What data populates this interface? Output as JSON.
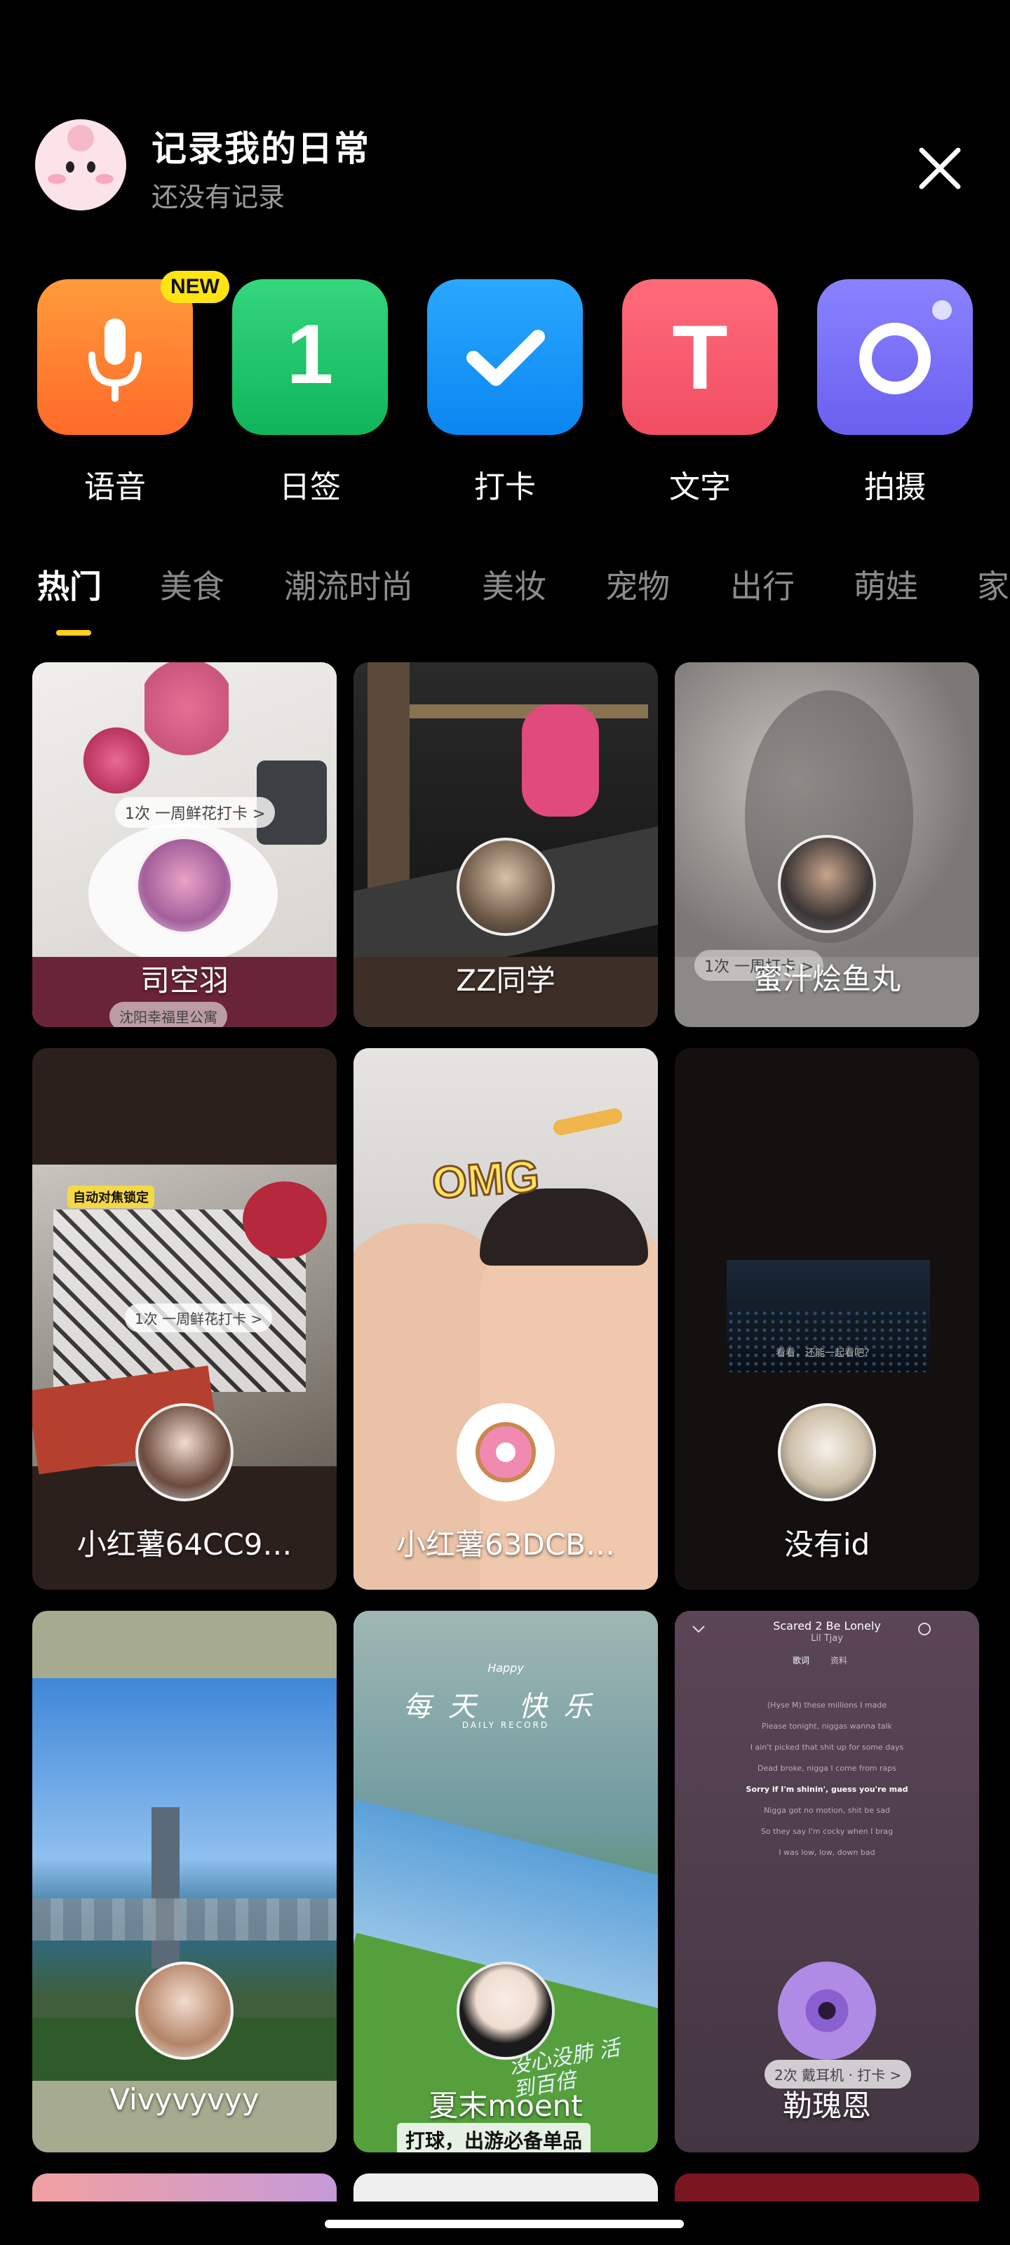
{
  "header": {
    "title": "记录我的日常",
    "subtitle": "还没有记录"
  },
  "actions": [
    {
      "label": "语音",
      "badge": "NEW",
      "icon": "microphone-icon",
      "color_top": "#ff9b3a",
      "color_bottom": "#ff6a2a"
    },
    {
      "label": "日签",
      "icon_text": "1",
      "icon": "calendar-sign-icon",
      "color_top": "#2fd57b",
      "color_bottom": "#12b85d"
    },
    {
      "label": "打卡",
      "icon": "checkmark-icon",
      "color_top": "#2aa8ff",
      "color_bottom": "#0a86f0"
    },
    {
      "label": "文字",
      "icon_text": "T",
      "icon": "text-icon",
      "color_top": "#ff6b7a",
      "color_bottom": "#f04e62"
    },
    {
      "label": "拍摄",
      "icon": "camera-icon",
      "color_top": "#8a82ff",
      "color_bottom": "#6b5ff0"
    }
  ],
  "tabs": [
    "热门",
    "美食",
    "潮流时尚",
    "美妆",
    "宠物",
    "出行",
    "萌娃",
    "家"
  ],
  "active_tab": 0,
  "cards": [
    {
      "name": "司空羽",
      "chip": "1次 一周鲜花打卡 >",
      "bottom_chip": "沈阳幸福里公寓"
    },
    {
      "name": "ZZ同学"
    },
    {
      "name": "蜜汁烩鱼丸",
      "chip": "1次 一周打卡 >"
    },
    {
      "name": "小红薯64CC9…",
      "chip": "1次 一周鲜花打卡 >",
      "tag": "自动对焦锁定"
    },
    {
      "name": "小红薯63DCB…",
      "sticker": "OMG"
    },
    {
      "name": "没有id",
      "chip": "看看，还能一起看吧？"
    },
    {
      "name": "Vivyvyvyy"
    },
    {
      "name": "夏末moent",
      "caption": "打球，出游必备单品",
      "overlay_text": "每天 快乐",
      "overlay_small": "Happy",
      "overlay_sub": "DAILY RECORD",
      "handwriting": "没心没肺 活到百倍"
    },
    {
      "name": "勒瑰恩",
      "song_title": "Scared 2 Be Lonely",
      "song_artist": "Lil Tjay",
      "chip": "2次 戴耳机 · 打卡 >",
      "lyrics": [
        "(Hyse M) these millions I made",
        "Please tonight, niggas wanna talk",
        "I ain't picked that shit up for some days",
        "Dead broke, nigga I come from raps",
        "Sorry if I'm shinin', guess you're mad",
        "Nigga got no motion, shit be sad",
        "So they say I'm cocky when I brag",
        "I was low, low, down bad"
      ],
      "song_tabs": [
        "歌词",
        "资料"
      ]
    }
  ]
}
